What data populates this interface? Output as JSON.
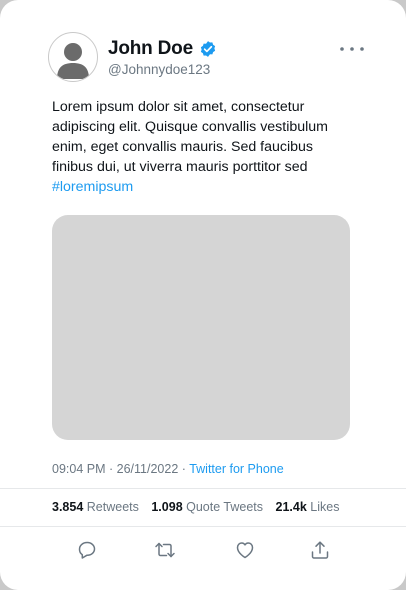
{
  "user": {
    "name": "John Doe",
    "handle": "@Johnnydoe123",
    "verified": true
  },
  "tweet": {
    "text": "Lorem ipsum dolor sit amet, consectetur adipiscing elit. Quisque convallis vestibulum enim, eget convallis mauris. Sed faucibus finibus dui, ut viverra mauris porttitor sed",
    "hashtag": "#loremipsum"
  },
  "meta": {
    "time": "09:04 PM",
    "date": "26/11/2022",
    "separator": "·",
    "source": "Twitter for Phone"
  },
  "stats": {
    "retweets_count": "3.854",
    "retweets_label": "Retweets",
    "quotes_count": "1.098",
    "quotes_label": "Quote Tweets",
    "likes_count": "21.4k",
    "likes_label": "Likes"
  },
  "colors": {
    "accent": "#1d9bf0",
    "text": "#0f1419",
    "muted": "#6b7782",
    "media_placeholder": "#d5d5d5"
  },
  "icons": {
    "more": "more-horizontal-icon",
    "verified": "verified-badge-icon",
    "reply": "reply-icon",
    "retweet": "retweet-icon",
    "like": "heart-icon",
    "share": "share-icon"
  }
}
